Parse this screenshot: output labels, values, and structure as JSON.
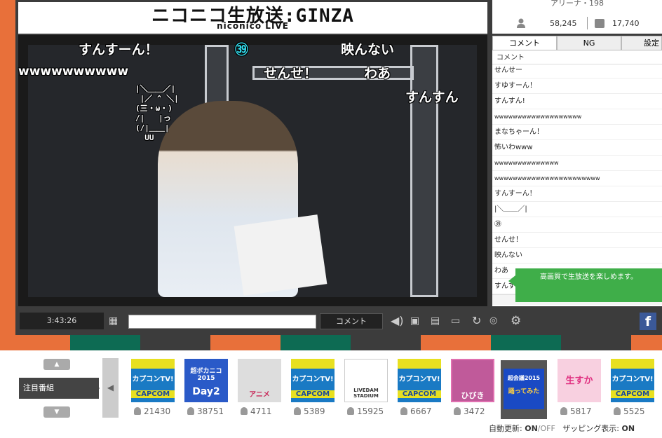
{
  "header": {
    "logo_main": "ニコニコ生放送:GINZA",
    "logo_sub": "niconico LIVE",
    "room_name": "アリーナ・198",
    "viewers": "58,245",
    "comments": "17,740"
  },
  "tabs": [
    "コメント",
    "NG",
    "設定"
  ],
  "comment_panel": {
    "header": "コメント",
    "rows": [
      "せんせー",
      "すゆすーん！",
      "すんすん!",
      "wwwwwwwwwwwwwwwwwww",
      "まなちゃーん！",
      "怖いわwww",
      "wwwwwwwwwwwwww",
      "wwwwwwwwwwwwwwwwwwwwwww",
      "すんすーん！",
      "|＼＿＿／|",
      "㊴",
      "せんせ！",
      "映んない",
      "わあ",
      "すんすん"
    ],
    "hq_notice": "高画質で生放送を楽しめます。"
  },
  "video": {
    "danmaku": [
      {
        "text": "すんすーん！",
        "id": "c1"
      },
      {
        "text": "㊴",
        "id": "c2"
      },
      {
        "text": "映んない",
        "id": "c3"
      },
      {
        "text": "wwwwwwwwww",
        "id": "c4"
      },
      {
        "text": "せんせ！",
        "id": "c5"
      },
      {
        "text": "わあ",
        "id": "c6"
      },
      {
        "text": "すんすん",
        "id": "c7"
      }
    ],
    "ascii_art": "|＼＿＿／|\n |／ ^ ＼|\n(三・ω・)\n/|   |っ\n(/|＿＿|\n  UU"
  },
  "controls": {
    "time": "3:43:26",
    "comment_button": "コメント",
    "input_placeholder": ""
  },
  "bottom": {
    "chumoku_label": "注目番組",
    "programs": [
      {
        "title": "カプコンTV!",
        "sub": "CAPCOM",
        "viewers": "21430"
      },
      {
        "title": "超ボカニコ2015",
        "sub": "Day2",
        "viewers": "38751"
      },
      {
        "title": "アニメ",
        "sub": "",
        "viewers": "4711"
      },
      {
        "title": "カプコンTV!",
        "sub": "CAPCOM",
        "viewers": "5389"
      },
      {
        "title": "LIVEDAM STADIUM",
        "sub": "",
        "viewers": "15925"
      },
      {
        "title": "カプコンTV!",
        "sub": "CAPCOM",
        "viewers": "6667"
      },
      {
        "title": "ひびき",
        "sub": "",
        "viewers": "3472"
      },
      {
        "title": "超会議2015",
        "sub": "踊ってみた",
        "viewers": ""
      },
      {
        "title": "生すか",
        "sub": "",
        "viewers": "5817"
      },
      {
        "title": "カプコンTV!",
        "sub": "CAPCOM",
        "viewers": "5525"
      }
    ],
    "auto_update_label": "自動更新:",
    "on": "ON",
    "off": "/OFF",
    "zapping_label": "ザッピング表示:",
    "zapping_on": "ON"
  },
  "colors": {
    "accent_orange": "#e8703a",
    "dark_green": "#0d6b53",
    "dark": "#3c3c3c",
    "notice_green": "#3fae49"
  }
}
